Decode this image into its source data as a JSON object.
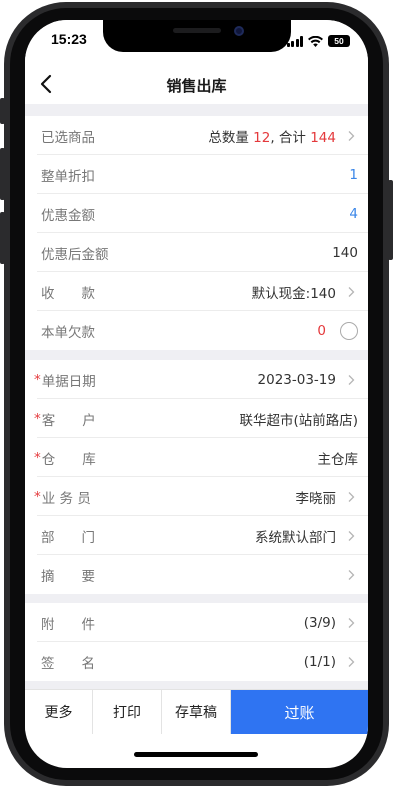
{
  "status_bar": {
    "time": "15:23",
    "battery": "50",
    "icons": [
      "signal-icon",
      "wifi-icon",
      "battery-icon"
    ]
  },
  "nav": {
    "title": "销售出库",
    "back_icon": "chevron-left-icon"
  },
  "summary": {
    "selected_goods": {
      "label": "已选商品",
      "qty_prefix": "总数量 ",
      "qty": "12",
      "sum_prefix": ", 合计 ",
      "sum": "144"
    },
    "discount": {
      "label": "整单折扣",
      "value": "1"
    },
    "promo_amount": {
      "label": "优惠金额",
      "value": "4"
    },
    "after_promo": {
      "label": "优惠后金额",
      "value": "140"
    },
    "payment": {
      "label": "收　　款",
      "value": "默认现金:140"
    },
    "debt": {
      "label": "本单欠款",
      "value": "0"
    }
  },
  "doc_info": {
    "date": {
      "label": "单据日期",
      "value": "2023-03-19"
    },
    "customer": {
      "label": "客　　户",
      "value": "联华超市(站前路店)"
    },
    "warehouse": {
      "label": "仓　　库",
      "value": "主仓库"
    },
    "salesperson": {
      "label": "业 务 员",
      "value": "李晓丽"
    },
    "department": {
      "label": "部　　门",
      "value": "系统默认部门"
    },
    "memo": {
      "label": "摘　　要",
      "value": ""
    }
  },
  "attachments": {
    "attachment": {
      "label": "附　　件",
      "value": "(3/9)"
    },
    "signature": {
      "label": "签　　名",
      "value": "(1/1)"
    }
  },
  "required_mark": "*",
  "actions": {
    "more": "更多",
    "print": "打印",
    "draft": "存草稿",
    "post": "过账"
  },
  "colors": {
    "accent": "#2f74f2",
    "red": "#e4393c",
    "blue": "#3a86e8",
    "gap": "#efeff3"
  }
}
